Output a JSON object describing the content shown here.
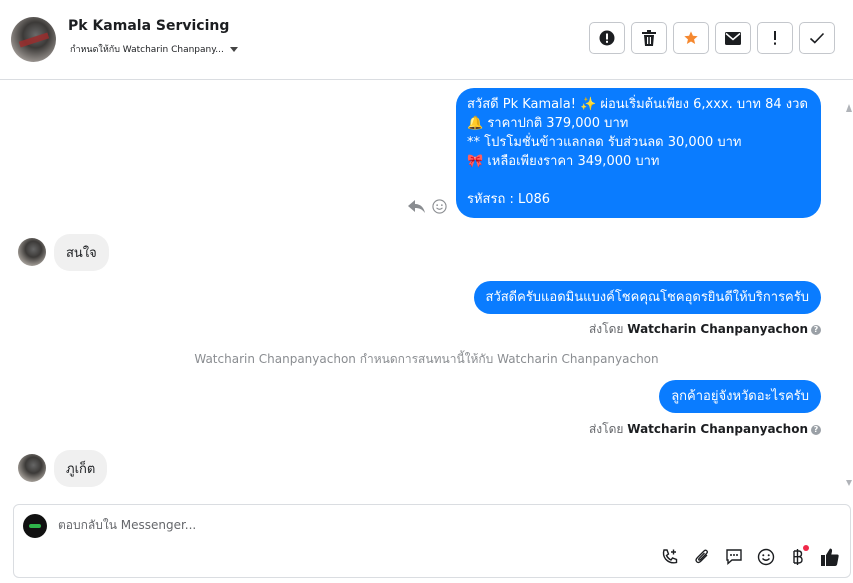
{
  "header": {
    "contact_name": "Pk Kamala Servicing",
    "assign_text": "กำหนดให้กับ Watcharin Chanpany...",
    "actions": [
      "report-icon",
      "trash-icon",
      "star-icon",
      "mail-icon",
      "important-icon",
      "check-icon"
    ],
    "colors": {
      "star": "#f5882f",
      "accent": "#0a7cff"
    }
  },
  "messages": {
    "outgoing_1": {
      "lines": [
        "สวัสดี Pk Kamala! ✨  ผ่อนเริ่มต้นเพียง 6,xxx. บาท 84 งวด",
        "🔔 ราคาปกติ 379,000 บาท",
        "** โปรโมชั่นข้าวแลกลด รับส่วนลด 30,000 บาท",
        "🎀  เหลือเพียงราคา 349,000 บาท",
        "",
        " รหัสรถ : L086"
      ]
    },
    "incoming_1": "สนใจ",
    "outgoing_2": "สวัสดีครับแอดมินแบงค์โชคคุณโชคอุดรยินดีให้บริการครับ",
    "outgoing_2_sent_prefix": "ส่งโดย",
    "outgoing_2_sender": "Watcharin Chanpanyachon",
    "system_note": "Watcharin Chanpanyachon กำหนดการสนทนานี้ให้กับ Watcharin Chanpanyachon",
    "outgoing_3": "ลูกค้าอยู่จังหวัดอะไรครับ",
    "outgoing_3_sent_prefix": "ส่งโดย",
    "outgoing_3_sender": "Watcharin Chanpanyachon",
    "incoming_2": "ภูเก็ต"
  },
  "composer": {
    "placeholder": "ตอบกลับใน Messenger...",
    "tools": [
      "call-add-icon",
      "attachment-icon",
      "saved-reply-icon",
      "emoji-icon",
      "payment-baht-icon",
      "like-icon"
    ]
  }
}
